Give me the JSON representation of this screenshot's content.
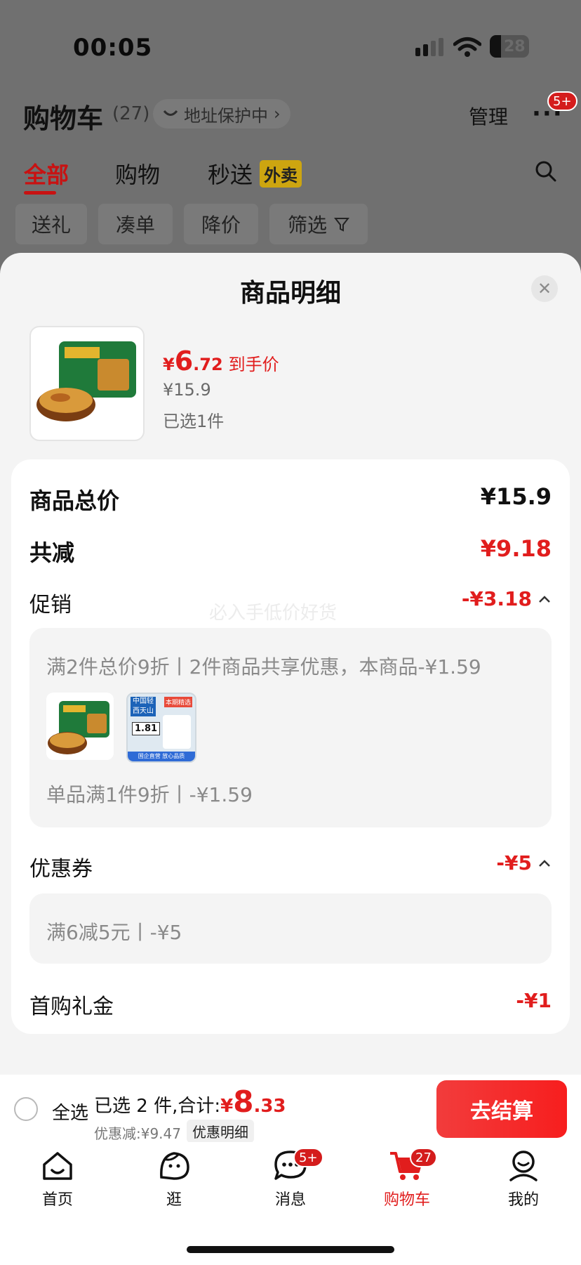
{
  "status_bar": {
    "time": "00:05",
    "battery": "28"
  },
  "header": {
    "title": "购物车",
    "count": "(27)",
    "address": "地址保护中",
    "manage": "管理",
    "more_badge": "5+"
  },
  "tabs": [
    {
      "label": "全部",
      "active": true
    },
    {
      "label": "购物",
      "active": false
    },
    {
      "label": "秒送",
      "active": false
    }
  ],
  "waimai_tag": "外卖",
  "chips": [
    "送礼",
    "凑单",
    "降价",
    "筛选"
  ],
  "sheet": {
    "title": "商品明细",
    "product": {
      "price_symbol": "¥",
      "price_int": "6",
      "price_dec": ".72",
      "price_label": "到手价",
      "original_price": "¥15.9",
      "selected": "已选1件"
    },
    "summary": {
      "total_label": "商品总价",
      "total_value": "¥15.9",
      "reduce_label": "共减",
      "reduce_value": "¥9.18",
      "promo_label": "促销",
      "promo_value": "-¥3.18",
      "promo_detail_1": "满2件总价9折丨2件商品共享优惠，本商品-¥1.59",
      "promo_detail_2": "单品满1件9折丨-¥1.59",
      "coupon_label": "优惠券",
      "coupon_value": "-¥5",
      "coupon_detail": "满6减5元丨-¥5",
      "gift_label": "首购礼金",
      "gift_value": "-¥1",
      "watermark": "必入手低价好货",
      "thumb2_text_a": "中国轻",
      "thumb2_text_b": "西天山",
      "thumb2_price": "1.81",
      "thumb2_tag": "本期精选",
      "thumb2_foot": "国企直营 放心品质"
    }
  },
  "bottom": {
    "select_all": "全选",
    "summary_prefix": "已选 2 件,合计:",
    "total_symbol": "¥",
    "total_int": "8",
    "total_dec": ".33",
    "discount": "优惠减:¥9.47",
    "detail_button": "优惠明细",
    "checkout": "去结算"
  },
  "tabbar": [
    {
      "label": "首页",
      "icon": "home-icon"
    },
    {
      "label": "逛",
      "icon": "face-icon"
    },
    {
      "label": "消息",
      "icon": "message-icon",
      "badge": "5+"
    },
    {
      "label": "购物车",
      "icon": "cart-icon",
      "badge": "27",
      "active": true
    },
    {
      "label": "我的",
      "icon": "profile-icon"
    }
  ],
  "colors": {
    "accent": "#e11d1d",
    "dim_overlay": "#707070"
  }
}
